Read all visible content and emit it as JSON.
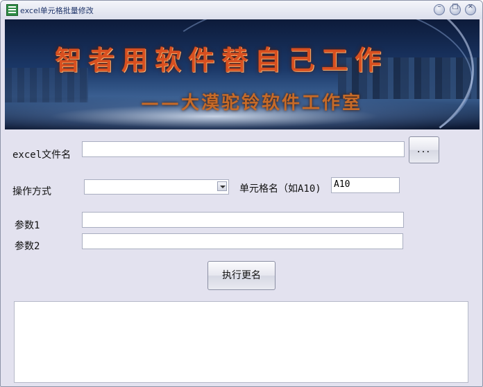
{
  "window": {
    "title": "excel单元格批量修改",
    "controls": {
      "minimize": "–",
      "maximize": "□",
      "close": "×"
    }
  },
  "banner": {
    "title": "智者用软件替自己工作",
    "subtitle": "——大漠驼铃软件工作室"
  },
  "form": {
    "file_label": "excel文件名",
    "file_value": "",
    "browse_label": "...",
    "operation_label": "操作方式",
    "operation_selected": "",
    "cell_label": "单元格名（如A10)",
    "cell_value": "A10",
    "param1_label": "参数1",
    "param1_value": "",
    "param2_label": "参数2",
    "param2_value": "",
    "execute_label": "执行更名"
  },
  "output": {
    "text": ""
  },
  "icons": {
    "app": "excel-sheet-icon",
    "dropdown": "chevron-down-icon"
  }
}
